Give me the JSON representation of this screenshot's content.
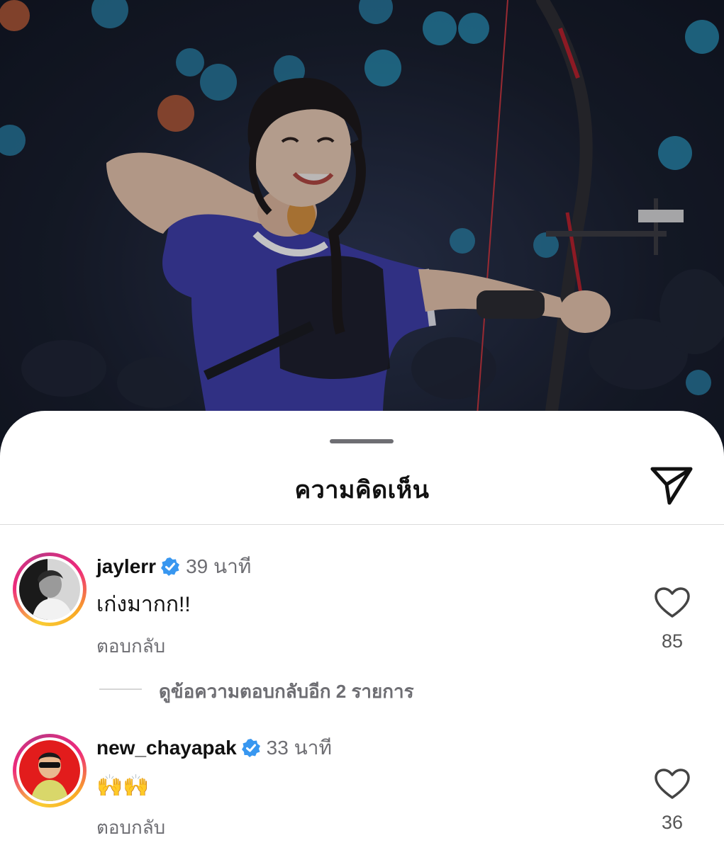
{
  "sheet": {
    "title": "ความคิดเห็น"
  },
  "comments": [
    {
      "username": "jaylerr",
      "time": "39 นาที",
      "text": "เก่งมากก!!",
      "reply_label": "ตอบกลับ",
      "likes": "85",
      "view_replies": "ดูข้อความตอบกลับอีก 2 รายการ"
    },
    {
      "username": "new_chayapak",
      "time": "33 นาที",
      "text": "🙌🙌",
      "reply_label": "ตอบกลับ",
      "likes": "36"
    }
  ],
  "colors": {
    "verified": "#3897f0",
    "muted_text": "#6e6e73",
    "story_ring_start": "#f9ce34",
    "story_ring_end": "#ee2a7b"
  },
  "icons": {
    "share": "paper-plane-icon",
    "like": "heart-outline-icon",
    "verified": "verified-badge-icon"
  }
}
